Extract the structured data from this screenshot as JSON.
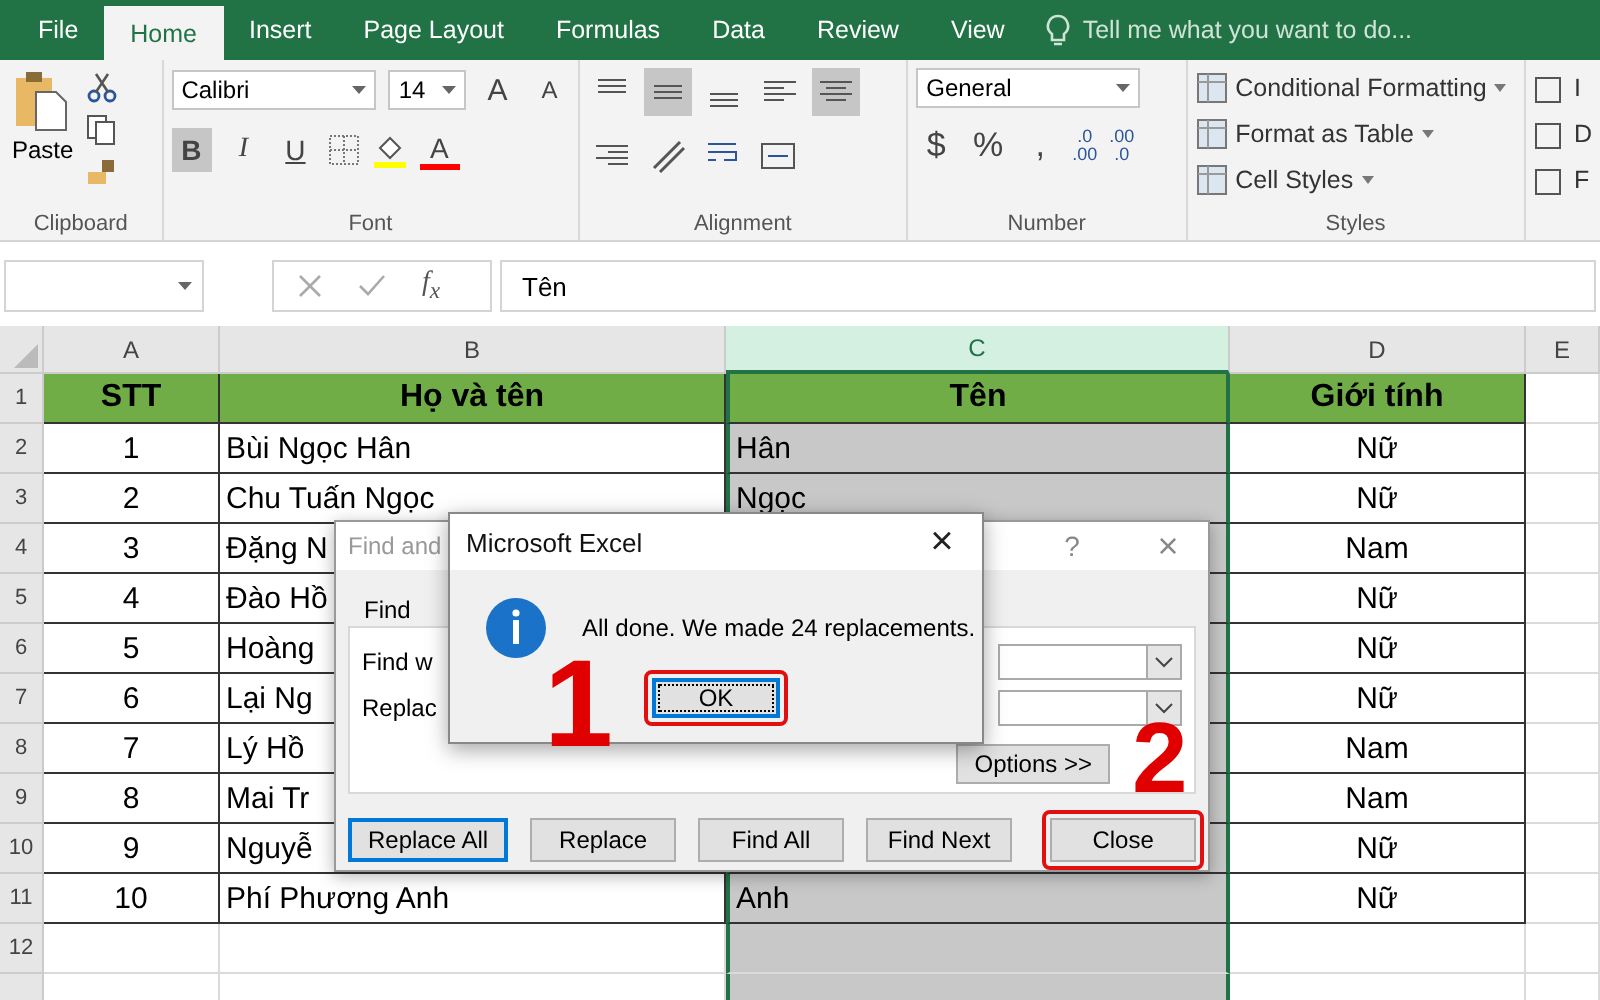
{
  "ribbon_tabs": [
    {
      "label": "File",
      "selected": false
    },
    {
      "label": "Home",
      "selected": true
    },
    {
      "label": "Insert",
      "selected": false
    },
    {
      "label": "Page Layout",
      "selected": false
    },
    {
      "label": "Formulas",
      "selected": false
    },
    {
      "label": "Data",
      "selected": false
    },
    {
      "label": "Review",
      "selected": false
    },
    {
      "label": "View",
      "selected": false
    }
  ],
  "tell_me": {
    "placeholder": "Tell me what you want to do..."
  },
  "clipboard": {
    "paste": "Paste",
    "group": "Clipboard"
  },
  "font": {
    "family": "Calibri",
    "size": "14",
    "grow": "A",
    "shrink": "A",
    "group": "Font",
    "styles": [
      {
        "kind": "bold",
        "label": "B",
        "on": true
      },
      {
        "kind": "italic",
        "label": "I",
        "on": false
      },
      {
        "kind": "underline",
        "label": "U",
        "on": false
      }
    ],
    "color_letter": "A"
  },
  "alignment": {
    "group": "Alignment",
    "buttons": [
      {
        "kind": "top",
        "on": false
      },
      {
        "kind": "middle",
        "on": true
      },
      {
        "kind": "bottom",
        "on": false
      },
      {
        "kind": "left",
        "on": false
      },
      {
        "kind": "center",
        "on": true
      },
      {
        "kind": "right",
        "on": false
      }
    ]
  },
  "number": {
    "group": "Number",
    "format": "General",
    "symbols": [
      "$",
      "%",
      ","
    ],
    "decimals": [
      {
        "top": ".0",
        "bottom": ".00"
      },
      {
        "top": ".00",
        "bottom": ".0"
      }
    ]
  },
  "styles": {
    "group": "Styles",
    "items": [
      "Conditional Formatting",
      "Format as Table",
      "Cell Styles"
    ]
  },
  "cells_group": {
    "items": [
      "I",
      "D",
      "F"
    ]
  },
  "formula_bar": {
    "fx": "f$_{x}$",
    "value": "Tên"
  },
  "sheet": {
    "columns": [
      {
        "label": "A",
        "selected": false
      },
      {
        "label": "B",
        "selected": false
      },
      {
        "label": "C",
        "selected": true
      },
      {
        "label": "D",
        "selected": false
      },
      {
        "label": "E",
        "selected": false
      }
    ],
    "rows": [
      {
        "number": "1",
        "kind": "header",
        "cells": [
          "STT",
          "Họ và tên",
          "Tên",
          "Giới tính"
        ]
      },
      {
        "number": "2",
        "kind": "data",
        "cells": [
          "1",
          "Bùi Ngọc Hân",
          "Hân",
          "Nữ"
        ]
      },
      {
        "number": "3",
        "kind": "data",
        "cells": [
          "2",
          "Chu Tuấn Ngọc",
          "Ngọc",
          "Nữ"
        ]
      },
      {
        "number": "4",
        "kind": "data",
        "cells": [
          "3",
          "Đặng N",
          null,
          "Nam"
        ]
      },
      {
        "number": "5",
        "kind": "data",
        "cells": [
          "4",
          "Đào Hồ",
          null,
          "Nữ"
        ]
      },
      {
        "number": "6",
        "kind": "data",
        "cells": [
          "5",
          "Hoàng",
          null,
          "Nữ"
        ]
      },
      {
        "number": "7",
        "kind": "data",
        "cells": [
          "6",
          "Lại Ng",
          null,
          "Nữ"
        ]
      },
      {
        "number": "8",
        "kind": "data",
        "cells": [
          "7",
          "Lý Hồ",
          null,
          "Nam"
        ]
      },
      {
        "number": "9",
        "kind": "data",
        "cells": [
          "8",
          "Mai Tr",
          null,
          "Nam"
        ]
      },
      {
        "number": "10",
        "kind": "data",
        "cells": [
          "9",
          "Nguyễ",
          null,
          "Nữ"
        ]
      },
      {
        "number": "11",
        "kind": "data",
        "cells": [
          "10",
          "Phí Phương Anh",
          "Anh",
          "Nữ"
        ]
      },
      {
        "number": "12",
        "kind": "empty"
      }
    ]
  },
  "find_dialog": {
    "title": "Find and",
    "help": "?",
    "close": "×",
    "tab": "Find",
    "find_label": "Find w",
    "replace_label": "Replac",
    "options": "Options >>",
    "buttons": [
      {
        "label": "Replace All",
        "focused": true,
        "highlighted": false
      },
      {
        "label": "Replace",
        "focused": false,
        "highlighted": false
      },
      {
        "label": "Find All",
        "focused": false,
        "highlighted": false
      },
      {
        "label": "Find Next",
        "focused": false,
        "highlighted": false
      },
      {
        "label": "Close",
        "focused": false,
        "highlighted": true
      }
    ]
  },
  "message_box": {
    "title": "Microsoft Excel",
    "close": "×",
    "message": "All done. We made 24 replacements.",
    "ok": "OK",
    "ok_highlighted": true
  },
  "annotations": [
    {
      "text": "1"
    },
    {
      "text": "2"
    }
  ]
}
